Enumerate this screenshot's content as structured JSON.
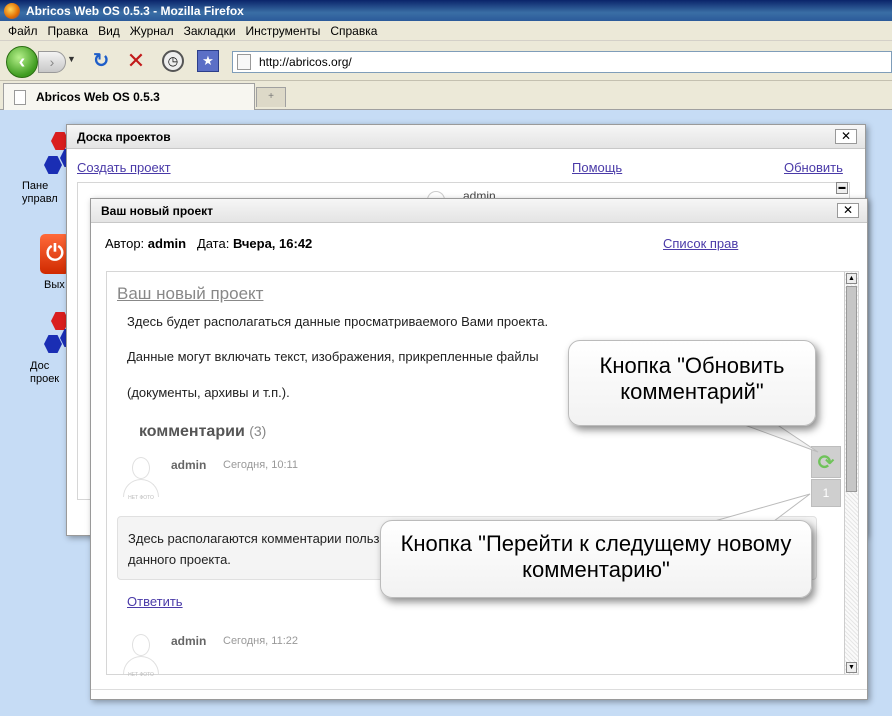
{
  "browser": {
    "window_title": "Abricos Web OS 0.5.3 - Mozilla Firefox",
    "menu": [
      "Файл",
      "Правка",
      "Вид",
      "Журнал",
      "Закладки",
      "Инструменты",
      "Справка"
    ],
    "url": "http://abricos.org/",
    "tab_title": "Abricos Web OS 0.5.3"
  },
  "desktop": {
    "icons": [
      {
        "label": "Пане\nуправл"
      },
      {
        "label": "Вых"
      },
      {
        "label": "Дос\nпроек"
      }
    ]
  },
  "board_window": {
    "title": "Доска проектов",
    "create_link": "Создать проект",
    "help_link": "Помощь",
    "refresh_link": "Обновить",
    "author_preview": "admin"
  },
  "project_window": {
    "title": "Ваш новый проект",
    "author_label": "Автор:",
    "author": "admin",
    "date_label": "Дата:",
    "date": "Вчера, 16:42",
    "rights_link": "Список прав",
    "project_heading": "Ваш новый проект",
    "paragraphs": [
      "Здесь будет располагаться данные просматриваемого Вами проекта.",
      "Данные могут включать текст, изображения, прикрепленные файлы",
      "(документы, архивы и т.п.)."
    ],
    "comments_title": "комментарии",
    "comments_count": "(3)",
    "comments": [
      {
        "author": "admin",
        "time": "Сегодня, 10:11",
        "text_line1": "Здесь располагаются комментарии пользоват",
        "text_line2": "данного проекта.",
        "reply": "Ответить"
      },
      {
        "author": "admin",
        "time": "Сегодня, 11:22"
      }
    ],
    "next_new_counter": "1",
    "avatar_caption": "НЕТ ФОТО"
  },
  "callouts": {
    "refresh": "Кнопка \"Обновить комментарий\"",
    "next": "Кнопка \"Перейти к следущему новому комментарию\""
  }
}
